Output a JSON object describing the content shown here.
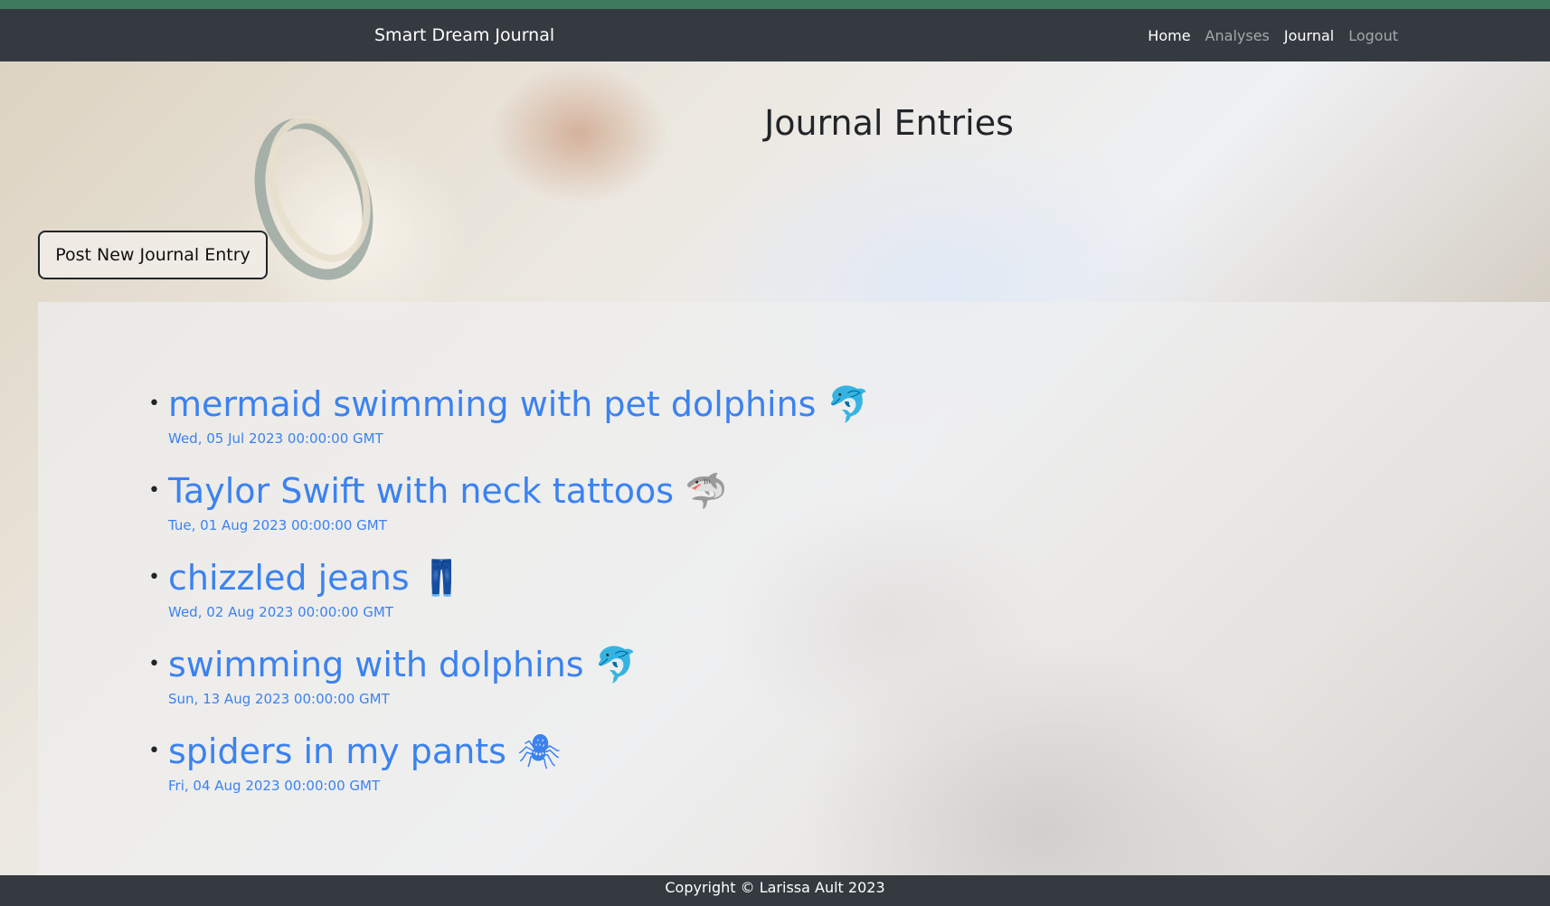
{
  "navbar": {
    "brand": "Smart Dream Journal",
    "links": [
      {
        "label": "Home",
        "active": true
      },
      {
        "label": "Analyses",
        "active": false
      },
      {
        "label": "Journal",
        "active": true
      },
      {
        "label": "Logout",
        "active": false
      }
    ]
  },
  "main": {
    "title": "Journal Entries",
    "post_button": "Post New Journal Entry",
    "entries": [
      {
        "title": "mermaid swimming with pet dolphins 🐬",
        "date": "Wed, 05 Jul 2023 00:00:00 GMT"
      },
      {
        "title": "Taylor Swift with neck tattoos 🦈",
        "date": "Tue, 01 Aug 2023 00:00:00 GMT"
      },
      {
        "title": "chizzled jeans 👖",
        "date": "Wed, 02 Aug 2023 00:00:00 GMT"
      },
      {
        "title": "swimming with dolphins 🐬",
        "date": "Sun, 13 Aug 2023 00:00:00 GMT"
      },
      {
        "title": "spiders in my pants 🕷",
        "date": "Fri, 04 Aug 2023 00:00:00 GMT"
      }
    ]
  },
  "footer": {
    "copyright": "Copyright © Larissa Ault 2023"
  },
  "colors": {
    "accent": "#3d7a5c",
    "navbar": "#343a40",
    "link": "#3b82f0"
  }
}
